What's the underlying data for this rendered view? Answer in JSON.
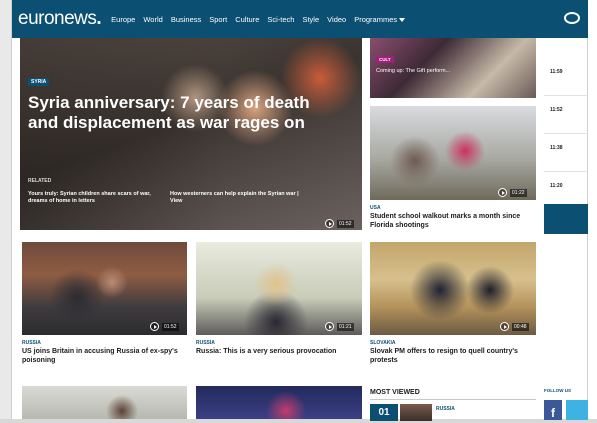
{
  "header": {
    "logo": {
      "bold": "euronews",
      "dot": "."
    },
    "nav": [
      "Europe",
      "World",
      "Business",
      "Sport",
      "Culture",
      "Sci-tech",
      "Style",
      "Video",
      "Programmes"
    ],
    "accent": "#0b4f73",
    "icons": {
      "programmes_dropdown": "chevron-down-icon",
      "right": "globe-icon"
    }
  },
  "hero": {
    "badge": "SYRIA",
    "title": "Syria anniversary: 7 years of death and displacement as war rages on",
    "related_label": "RELATED",
    "related": [
      "Yours truly: Syrian children share scars of war, dreams of home in letters",
      "How westerners can help explain the Syrian war | View"
    ],
    "duration": "01:52"
  },
  "right_column": {
    "top_tile": {
      "badge": "CULT",
      "text": "Coming up: The Gift perform..."
    },
    "walkout": {
      "region": "USA",
      "caption": "Student school walkout marks a month since Florida shootings",
      "duration": "01:22"
    }
  },
  "side_times": [
    "11:59",
    "11:52",
    "11:38",
    "11:20"
  ],
  "stories": [
    {
      "region": "RUSSIA",
      "caption": "US joins Britain in accusing Russia of ex-spy's poisoning",
      "duration": "01:52"
    },
    {
      "region": "RUSSIA",
      "caption": "Russia: This is a very serious provocation",
      "duration": "01:21"
    },
    {
      "region": "SLOVAKIA",
      "caption": "Slovak PM offers to resign to quell country's protests",
      "duration": "00:48"
    }
  ],
  "most_viewed": {
    "title": "MOST VIEWED",
    "rank": "01",
    "region": "RUSSIA"
  },
  "follow": {
    "label": "FOLLOW US",
    "fb": "f"
  }
}
